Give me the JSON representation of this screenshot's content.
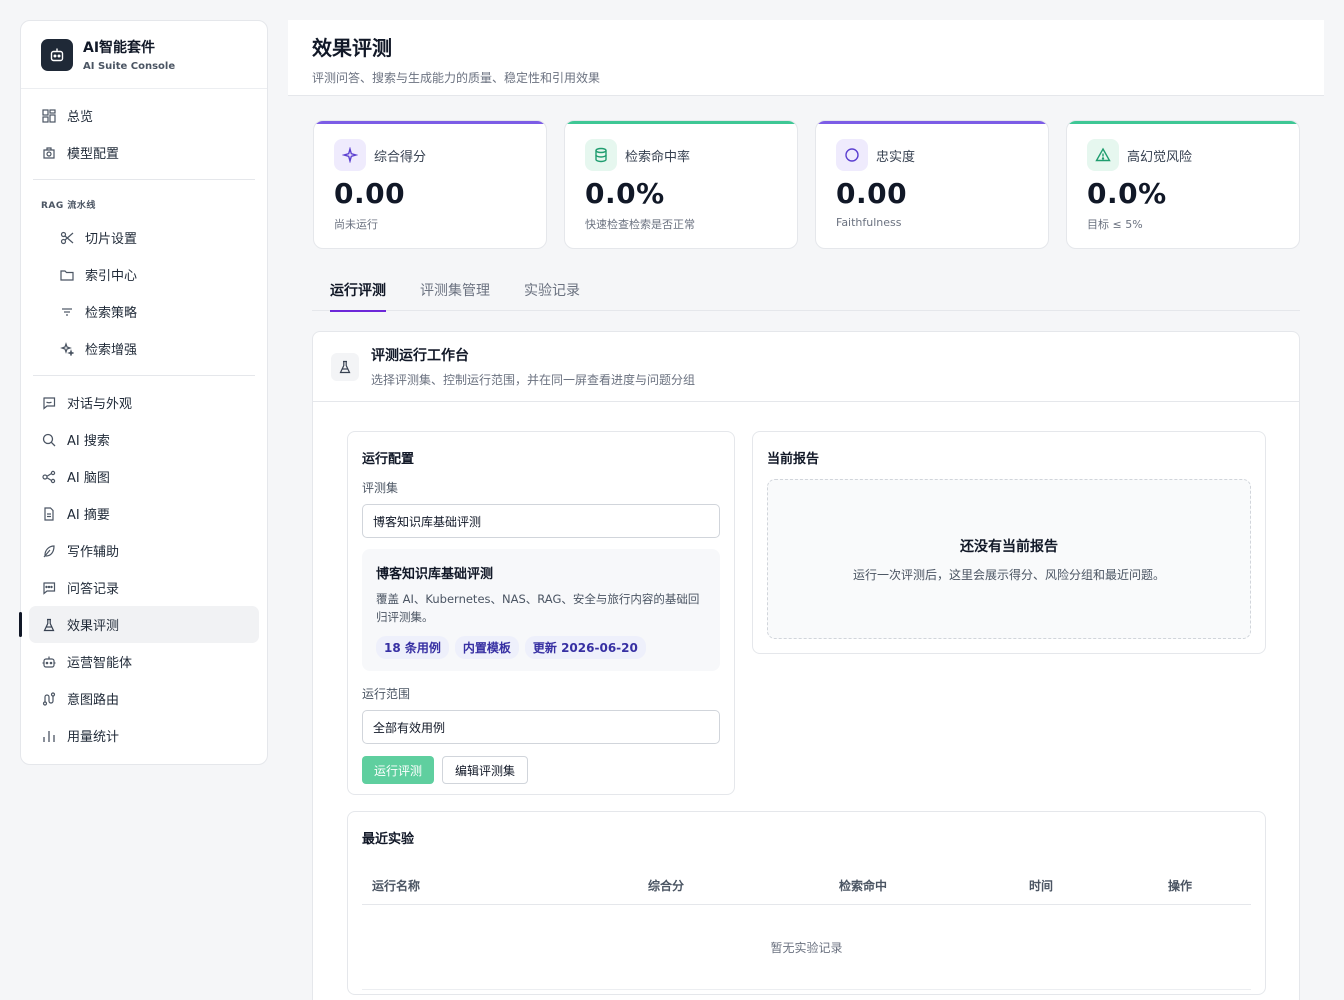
{
  "brand": {
    "title": "AI智能套件",
    "subtitle": "AI Suite Console"
  },
  "sidebar": {
    "items_top": [
      {
        "label": "总览",
        "icon": "dashboard-icon"
      },
      {
        "label": "模型配置",
        "icon": "model-icon"
      }
    ],
    "group_label": "RAG 流水线",
    "items_rag": [
      {
        "label": "切片设置",
        "icon": "scissors-icon"
      },
      {
        "label": "索引中心",
        "icon": "folder-icon"
      },
      {
        "label": "检索策略",
        "icon": "filter-icon"
      },
      {
        "label": "检索增强",
        "icon": "sparkle-icon"
      }
    ],
    "items_bottom": [
      {
        "label": "对话与外观",
        "icon": "chat-icon"
      },
      {
        "label": "AI 搜索",
        "icon": "search-icon"
      },
      {
        "label": "AI 脑图",
        "icon": "mindmap-icon"
      },
      {
        "label": "AI 摘要",
        "icon": "document-icon"
      },
      {
        "label": "写作辅助",
        "icon": "feather-icon"
      },
      {
        "label": "问答记录",
        "icon": "message-icon"
      },
      {
        "label": "效果评测",
        "icon": "flask-icon",
        "active": true
      },
      {
        "label": "运营智能体",
        "icon": "robot-icon"
      },
      {
        "label": "意图路由",
        "icon": "route-icon"
      },
      {
        "label": "用量统计",
        "icon": "bar-chart-icon"
      }
    ]
  },
  "header": {
    "title": "效果评测",
    "subtitle": "评测问答、搜索与生成能力的质量、稳定性和引用效果"
  },
  "stats": [
    {
      "label": "综合得分",
      "value": "0.00",
      "note": "尚未运行",
      "icon": "sparkle-icon",
      "accent": "#7c5ce6",
      "icon_bg": "#efebfd"
    },
    {
      "label": "检索命中率",
      "value": "0.0%",
      "note": "快速检查检索是否正常",
      "icon": "database-icon",
      "accent": "#3ec795",
      "icon_bg": "#e6f7ef"
    },
    {
      "label": "忠实度",
      "value": "0.00",
      "note": "Faithfulness",
      "icon": "circle-icon",
      "accent": "#7c5ce6",
      "icon_bg": "#efebfd"
    },
    {
      "label": "高幻觉风险",
      "value": "0.0%",
      "note": "目标 ≤ 5%",
      "icon": "warning-icon",
      "accent": "#3ec795",
      "icon_bg": "#e6f7ef"
    }
  ],
  "tabs": [
    "运行评测",
    "评测集管理",
    "实验记录"
  ],
  "workbench": {
    "title": "评测运行工作台",
    "subtitle": "选择评测集、控制运行范围，并在同一屏查看进度与问题分组"
  },
  "run_config": {
    "title": "运行配置",
    "dataset_label": "评测集",
    "dataset_value": "博客知识库基础评测",
    "dataset_card": {
      "title": "博客知识库基础评测",
      "description": "覆盖 AI、Kubernetes、NAS、RAG、安全与旅行内容的基础回归评测集。",
      "chips": [
        "18 条用例",
        "内置模板",
        "更新 2026-06-20"
      ]
    },
    "scope_label": "运行范围",
    "scope_value": "全部有效用例",
    "run_button": "运行评测",
    "edit_button": "编辑评测集"
  },
  "report": {
    "title": "当前报告",
    "empty_title": "还没有当前报告",
    "empty_desc": "运行一次评测后，这里会展示得分、风险分组和最近问题。"
  },
  "experiments": {
    "title": "最近实验",
    "columns": [
      "运行名称",
      "综合分",
      "检索命中",
      "时间",
      "操作"
    ],
    "empty": "暂无实验记录"
  }
}
